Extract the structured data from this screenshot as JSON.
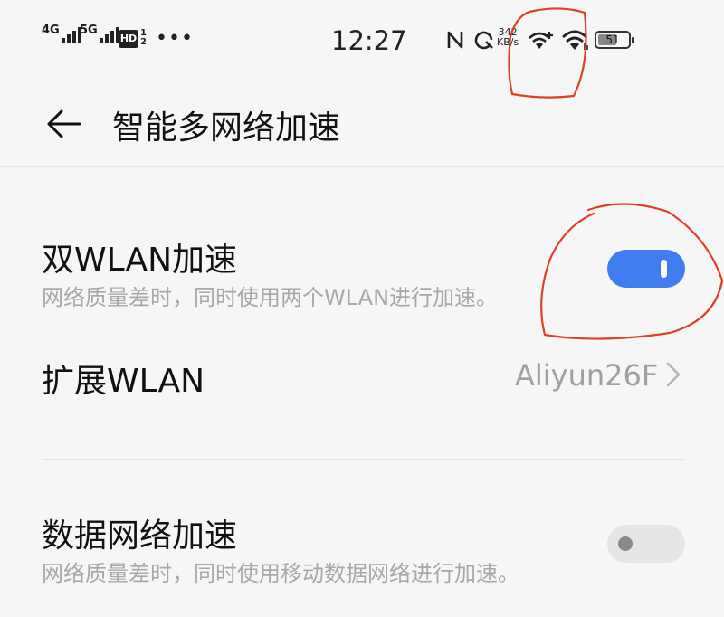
{
  "status_bar": {
    "net1": "4G",
    "net2": "5G",
    "hd": "HD",
    "hd_sub_top": "1",
    "hd_sub_bottom": "2",
    "more": "•••",
    "time": "12:27",
    "speed_value": "342",
    "speed_unit": "KB/s",
    "battery_level": "51",
    "icons": [
      "nfc-icon",
      "speed-indicator-icon",
      "wifi-plus-icon",
      "wifi-icon",
      "battery-icon"
    ]
  },
  "header": {
    "back_icon": "back-arrow-icon",
    "title": "智能多网络加速"
  },
  "settings": {
    "dual_wlan": {
      "title": "双WLAN加速",
      "subtitle": "网络质量差时，同时使用两个WLAN进行加速。",
      "enabled": true
    },
    "extended_wlan": {
      "title": "扩展WLAN",
      "value": "Aliyun26F"
    },
    "mobile_data": {
      "title": "数据网络加速",
      "subtitle": "网络质量差时，同时使用移动数据网络进行加速。",
      "enabled": false
    }
  },
  "colors": {
    "accent": "#3f7df0",
    "background": "#f6f6f6",
    "annotation": "#e0402a"
  }
}
